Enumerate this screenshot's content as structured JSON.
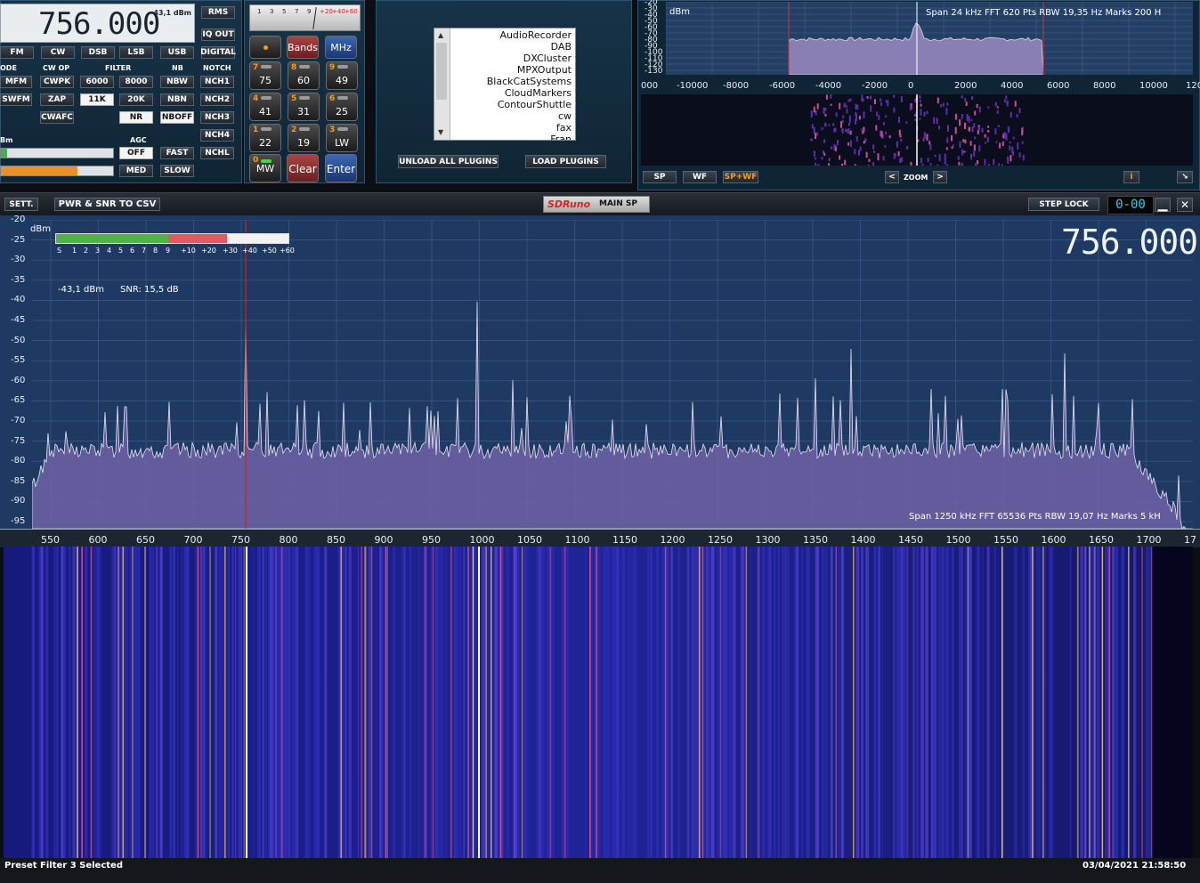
{
  "main_panel": {
    "frequency": "756.000",
    "level": "-43,1 dBm",
    "rms_button": "RMS",
    "iqout_button": "IQ OUT",
    "digital_button": "DIGITAL",
    "modes": [
      "FM",
      "CW",
      "DSB",
      "LSB",
      "USB"
    ],
    "section_labels": {
      "mode": "ODE",
      "cwop": "CW OP",
      "filter": "FILTER",
      "nb": "NB",
      "notch": "NOTCH",
      "agc": "AGC",
      "dbm": "Bm"
    },
    "row2": [
      "MFM",
      "CWPK",
      "6000",
      "8000",
      "NBW",
      "NCH1"
    ],
    "row3": [
      "SWFM",
      "ZAP",
      "11K",
      "20K",
      "NBN",
      "NCH2"
    ],
    "row4": [
      "CWAFC",
      "NR",
      "NBOFF",
      "NCH3"
    ],
    "nch4": "NCH4",
    "agc": [
      "OFF",
      "FAST",
      "NCHL",
      "MED",
      "SLOW"
    ]
  },
  "keypad": {
    "bands": "Bands",
    "mhz": "MHz",
    "keys": [
      {
        "n": "7",
        "v": "75"
      },
      {
        "n": "8",
        "v": "60"
      },
      {
        "n": "9",
        "v": "49"
      },
      {
        "n": "4",
        "v": "41"
      },
      {
        "n": "5",
        "v": "31"
      },
      {
        "n": "6",
        "v": "25"
      },
      {
        "n": "1",
        "v": "22"
      },
      {
        "n": "2",
        "v": "19"
      },
      {
        "n": "3",
        "v": "LW"
      }
    ],
    "zero": {
      "n": "0",
      "v": "MW"
    },
    "clear": "Clear",
    "enter": "Enter",
    "smeter_scale": [
      "1",
      "3",
      "5",
      "7",
      "9",
      "+20",
      "+40",
      "+60"
    ]
  },
  "plugins": {
    "items": [
      "AudioRecorder",
      "DAB",
      "DXCluster",
      "MPXOutput",
      "BlackCatSystems",
      "CloudMarkers",
      "ContourShuttle",
      "cw",
      "fax",
      "Fran"
    ],
    "unload": "UNLOAD ALL PLUGINS",
    "load": "LOAD PLUGINS"
  },
  "aux_spectrum": {
    "dbm": "dBm",
    "info": "Span 24 kHz   FFT 620 Pts   RBW 19,35 Hz   Marks 200 H",
    "y_ticks": [
      "-20",
      "-30",
      "-40",
      "-50",
      "-60",
      "-70",
      "-80",
      "-90",
      "-100",
      "-110",
      "-120",
      "-130"
    ],
    "x_ticks": [
      "000",
      "-10000",
      "-8000",
      "-6000",
      "-4000",
      "-2000",
      "0",
      "2000",
      "4000",
      "6000",
      "8000",
      "10000",
      "120"
    ],
    "buttons": {
      "sp": "SP",
      "wf": "WF",
      "spwf": "SP+WF",
      "zoom": "ZOOM",
      "prev": "<",
      "next": ">",
      "info": "i"
    }
  },
  "main_sp": {
    "sett": "SETT.",
    "csv": "PWR & SNR TO CSV",
    "logo": "SDRuno",
    "title": "MAIN SP",
    "step_lock": "STEP LOCK",
    "step_value": "0-00",
    "frequency": "756.000",
    "dbm_label": "dBm",
    "level_readout": "-43,1 dBm",
    "snr_readout": "SNR: 15,5 dB",
    "smeter_labels": [
      "S",
      "1",
      "2",
      "3",
      "4",
      "5",
      "6",
      "7",
      "8",
      "9",
      "+10",
      "+20",
      "+30",
      "+40",
      "+50",
      "+60"
    ],
    "info": "Span 1250 kHz   FFT 65536 Pts   RBW 19,07 Hz   Marks 5 kH",
    "y_ticks": [
      "-20",
      "-25",
      "-30",
      "-35",
      "-40",
      "-45",
      "-50",
      "-55",
      "-60",
      "-65",
      "-70",
      "-75",
      "-80",
      "-85",
      "-90",
      "-95"
    ],
    "x_ticks": [
      "550",
      "600",
      "650",
      "700",
      "750",
      "800",
      "850",
      "900",
      "950",
      "1000",
      "1050",
      "1100",
      "1150",
      "1200",
      "1250",
      "1300",
      "1350",
      "1400",
      "1450",
      "1500",
      "1550",
      "1600",
      "1650",
      "1700",
      "17"
    ]
  },
  "status": {
    "left": "Preset Filter 3 Selected",
    "right": "03/04/2021 21:58:50"
  }
}
